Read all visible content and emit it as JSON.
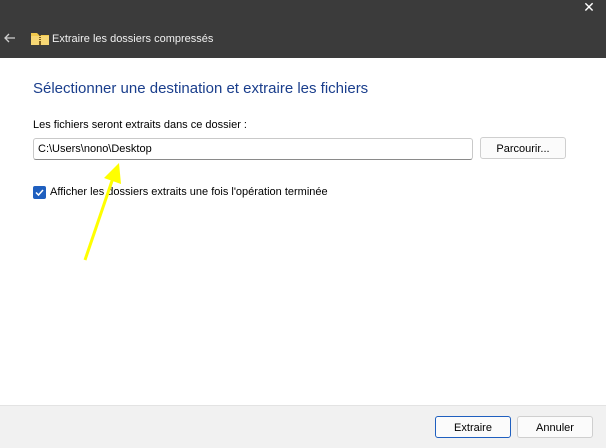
{
  "window": {
    "title": "Extraire les dossiers compressés",
    "close_glyph": "✕"
  },
  "main": {
    "heading": "Sélectionner une destination et extraire les fichiers",
    "field_label": "Les fichiers seront extraits dans ce dossier :",
    "path_value": "C:\\Users\\nono\\Desktop",
    "browse_label": "Parcourir...",
    "checkbox_label": "Afficher les dossiers extraits une fois l'opération terminée",
    "checkbox_checked": true
  },
  "footer": {
    "extract_label": "Extraire",
    "cancel_label": "Annuler"
  },
  "colors": {
    "titlebar": "#3b3b3b",
    "heading": "#1a3e8c",
    "accent": "#1f5fbf",
    "annotation_arrow": "#ffff00"
  },
  "icons": {
    "back": "back-arrow-icon",
    "folder": "zip-folder-icon",
    "close": "close-icon",
    "check": "checkmark-icon"
  }
}
